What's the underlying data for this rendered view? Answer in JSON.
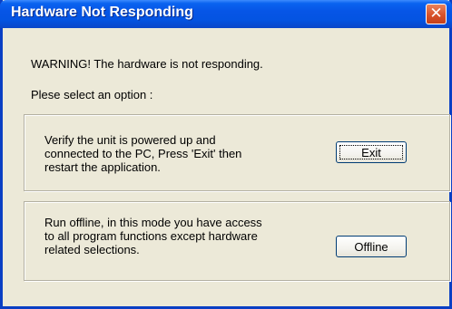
{
  "dialog": {
    "title": "Hardware Not Responding",
    "close_glyph": "✕",
    "warning": "WARNING!  The hardware is not responding.",
    "prompt": "Plese select an option :",
    "exit_option": {
      "text": "Verify the unit is powered up and\nconnected to the PC,  Press 'Exit' then\nrestart the application.",
      "button_label": "Exit"
    },
    "offline_option": {
      "text": "Run offline,  in this mode you have access\nto all program functions except hardware\nrelated selections.",
      "button_label": "Offline"
    }
  },
  "colors": {
    "titlebar": "#0454e2",
    "window_bg": "#ece9d8",
    "close_button": "#d8522a"
  },
  "icons": {
    "close": "close-icon"
  }
}
